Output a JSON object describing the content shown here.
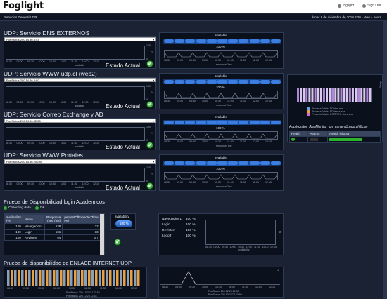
{
  "topbar": {
    "logo": "Foglight",
    "user": "foglight",
    "signout": "Sign Out"
  },
  "subbar": {
    "left": "Servicios General UDP",
    "right": "lunes 6 de diciembre de 2010 8:20 - Now 4 hours"
  },
  "time_ticks": [
    "08:30",
    "09:00",
    "09:30",
    "10:00",
    "10:30",
    "11:00",
    "11:30",
    "12:00",
    "12:15"
  ],
  "services": [
    {
      "title": "UDP: Servicio DNS EXTERNOS",
      "select": "PortStatus 200.14.86.4:53",
      "estado": "Estado Actual",
      "ytop": "100",
      "ybottom": "0",
      "yunit": "%",
      "legend": "available",
      "avail_title": "available",
      "avail_pct": "100 %",
      "rt_legend": "responseTime"
    },
    {
      "title": "UDP: Servicio WWW udp.cl (web2)",
      "select": "PortStatus 200.14.86.8:80",
      "estado": "Estado Actual",
      "ytop": "100",
      "ybottom": "0",
      "yunit": "%",
      "legend": "available",
      "avail_title": "available",
      "avail_pct": "100 %",
      "rt_legend": "responseTime"
    },
    {
      "title": "UDP: Servicio Correo Exchange y AD",
      "select": "PortStatus 200.14.86.32:25",
      "estado": "Estado Actual",
      "ytop": "100",
      "ybottom": "0",
      "yunit": "%",
      "legend": "available",
      "avail_title": "available",
      "avail_pct": "100 %",
      "rt_legend": "responseTime"
    },
    {
      "title": "UDP: Servicio WWW Portales",
      "select": "PortStatus 200.14.86.200:80",
      "estado": "Estado Actual",
      "ytop": "100",
      "ybottom": "0",
      "yunit": "%",
      "legend": "available",
      "avail_title": "available",
      "avail_pct": "100 %",
      "rt_legend": "responseTime"
    }
  ],
  "right_panel": {
    "legend": [
      {
        "label": "ProcessTotals: AD dns.exe",
        "color": "#6aa0e8"
      },
      {
        "label": "ProcessTotals: AD lsass.exe",
        "color": "#e8a040"
      },
      {
        "label": "ProcessTotals: CORREO store.exe",
        "color": "#d070c0"
      }
    ],
    "ylabel": "Swap",
    "monitor_title": "AppMonitor_AppMonitor_on_carrera3.udp.cl@carr",
    "headers": [
      "Health",
      "Alarms",
      "Health History"
    ]
  },
  "login": {
    "title": "Prueba de Disponibilidad login Academicos",
    "collecting": "Collecting data",
    "ok": "OK",
    "headers": [
      "availability (%)",
      "Name",
      "Response Time (ms)",
      "percentOfExpectedTime (%)"
    ],
    "rows": [
      [
        "100",
        "Navegación1",
        "638",
        "22"
      ],
      [
        "100",
        "Login",
        "531",
        "33"
      ],
      [
        "100",
        "Revisten",
        "94",
        "6,7"
      ]
    ],
    "gauge_title": "availability",
    "gauge_pct": "100 %",
    "stats": [
      [
        "Navegación1",
        "100 %"
      ],
      [
        "Login",
        "100 %"
      ],
      [
        "Revisten",
        "100 %"
      ],
      [
        "Logoff",
        "100 %"
      ]
    ],
    "bar_legend": "availability",
    "bar_pct": "%"
  },
  "enlace": {
    "title": "Prueba de disponibilidad de ENLACE INTERNET UDP",
    "legend": [
      "PortStatus 200.10.227.170:53",
      "PortStatus 200.12.28.11:53"
    ],
    "rt_legend": [
      "PortStatus 200.12.28.11:80",
      "PortStatus 200.10.227.170:80"
    ],
    "ytop": "4"
  },
  "colors": {
    "ok": "#2fb02f",
    "available": "#3b7de0",
    "bar_a": "#8a9fb8",
    "bar_b": "#e8a040"
  }
}
